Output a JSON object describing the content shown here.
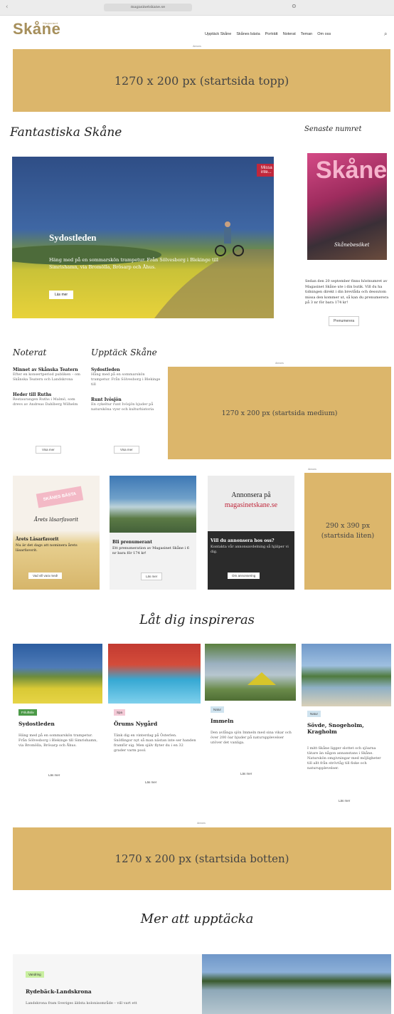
{
  "browser": {
    "url": "magasinetskane.se"
  },
  "header": {
    "logo": "Skåne",
    "logo_sub": "Magasinet",
    "nav": [
      "Upptäck Skåne",
      "Skånes bästa",
      "Porträtt",
      "Noterat",
      "Teman",
      "Om oss"
    ]
  },
  "ads": {
    "label": "Annons",
    "top": "1270 x 200 px (startsida topp)",
    "medium": "1270 x 200 px (startsida medium)",
    "small": "290 x 390 px (startsida liten)",
    "bottom": "1270 x 200 px (startsida botten)"
  },
  "hero_section": {
    "heading": "Fantastiska Skåne",
    "badge": "Missa inte...",
    "title": "Sydostleden",
    "description": "Häng med på en sommarskön trampetur. Från Sölvesborg i Blekinge till Simrishamn, via Bromölla, Brösarp och Åhus.",
    "button": "Läs mer"
  },
  "latest_issue": {
    "heading": "Senaste numret",
    "cover_title": "Skåne",
    "cover_subtitle": "Skånebesöket",
    "text": "Sedan den 20 september finns höstnumret av Magasinet Skåne ute i din butik. Vill du ha tidningen direkt i din brevlåda och dessutom missa den kommer ut, så kan du prenumerera på 3 nr för bara 174 kr!",
    "button": "Prenumerera"
  },
  "noterat": {
    "heading": "Noterat",
    "items": [
      {
        "title": "Minnet av Skånska Teatern",
        "text": "Efter en konsertperiod publiken – om Skånska Teatern och Landskrona"
      },
      {
        "title": "Heder till Ruths",
        "text": "Restaurangen Ruths i Malmö, som drevs av Andreas Dahlberg Wilhelm"
      }
    ],
    "button": "Visa mer"
  },
  "upptack": {
    "heading": "Upptäck Skåne",
    "items": [
      {
        "title": "Sydostleden",
        "text": "Häng med på en sommarskön trampetur. Från Sölvesborg i Blekinge till"
      },
      {
        "title": "Runt Ivösjön",
        "text": "En cykeltur runt Ivösjön bjuder på natursköna vyer och kulturhistoria"
      }
    ],
    "button": "Visa mer"
  },
  "promos": [
    {
      "badge": "SKÅNES BÄSTA",
      "script": "Årets läsarfavorit",
      "title": "Årets Läsarfavorit",
      "text": "Nu är det dags att nominera årets läsarfavorit.",
      "button": "Vad vill vara med!"
    },
    {
      "title": "Bli prenumerant",
      "text": "Ett prenumeration av Magasinet Skåne i 6 nr bara för 174 kr!",
      "button": "Läs mer"
    },
    {
      "heading": "Annonsera på",
      "heading_accent": "magasinetskane.se",
      "title": "Vill du annonsera hos oss?",
      "text": "Kontakta vår annonsavdelning så hjälper vi dig.",
      "button": "Om annonsering"
    }
  ],
  "inspire": {
    "heading": "Låt dig inspireras",
    "items": [
      {
        "tag": "Friluftsliv",
        "title": "Sydostleden",
        "text": "Häng med på en sommarskön trampetur. Från Sölvesborg i Blekinge till Simrishamn, via Bromölla, Brösarp och Åhus.",
        "button": "Läs mer"
      },
      {
        "tag": "Spa",
        "title": "Örums Nygård",
        "text": "Tänk dig en vinterdag på Österlen. Snöflingor nyt så man nästan inte ser handen framför sig. Men själv flyter du i en 32 grader varm pool.",
        "button": "Läs mer"
      },
      {
        "tag": "Natur",
        "title": "Immeln",
        "text": "Den avlånga sjön Immeln med sina vikar och över 200 öar bjuder på naturupplevelser utöver det vanliga.",
        "button": "Läs mer"
      },
      {
        "tag": "Natur",
        "title": "Sövde, Snogeholm, Kragholm",
        "text": "I mitt-Skåne ligger slottet och sjöarna tätare än någon annanstans i Skåne. Naturskön omgivningar med möjligheter till allt från strövtåg till fiske och naturupplevelser.",
        "button": "Läs mer"
      }
    ]
  },
  "more": {
    "heading": "Mer att upptäcka",
    "tag": "Vandring",
    "title": "Rydebäck-Landskrona",
    "text": "Landskrona fram Sveriges äldsta kolonisområde – vill vart ett"
  },
  "colors": {
    "gold": "#dcb66b",
    "red": "#c0283c",
    "green": "#4c9a48",
    "dark": "#2b2b2b"
  }
}
